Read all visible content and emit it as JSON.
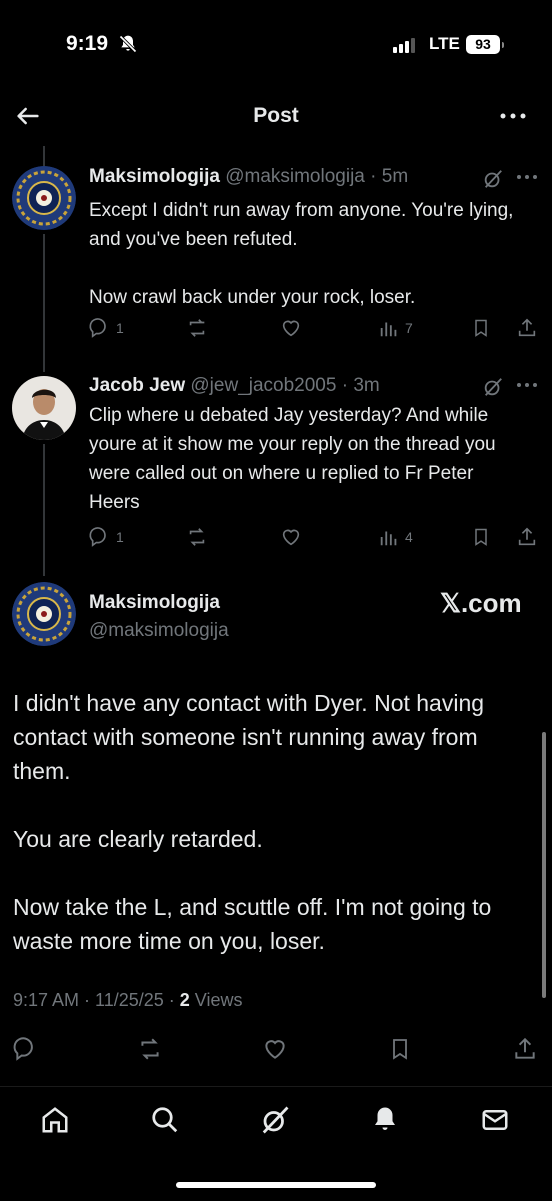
{
  "status": {
    "time": "9:19",
    "network": "LTE",
    "battery": "93"
  },
  "header": {
    "title": "Post"
  },
  "replies": [
    {
      "name": "Maksimologija",
      "handle": "@maksimologija",
      "time": "5m",
      "body": "Except I didn't run away from anyone. You're lying, and you've been refuted.\n\nNow crawl back under your rock, loser.",
      "replies": "1",
      "views": "7"
    },
    {
      "name": "Jacob Jew",
      "handle": "@jew_jacob2005",
      "time": "3m",
      "body": "Clip where u debated Jay yesterday? And while youre at it show me your reply on the thread you were called out on where u replied to Fr Peter Heers",
      "replies": "1",
      "views": "4"
    }
  ],
  "main": {
    "name": "Maksimologija",
    "handle": "@maksimologija",
    "watermark": "𝕏.com",
    "body": "I didn't have any contact with Dyer. Not having contact with someone isn't running away from them.\n\nYou are clearly retarded.\n\nNow take the L, and scuttle off. I'm not going to waste more time on you, loser.",
    "timestamp": "9:17 AM · 11/25/25 · ",
    "views_count": "2",
    "views_label": " Views"
  },
  "colors": {
    "background": "#000000",
    "text": "#e7e9ea",
    "muted": "#71767b"
  }
}
